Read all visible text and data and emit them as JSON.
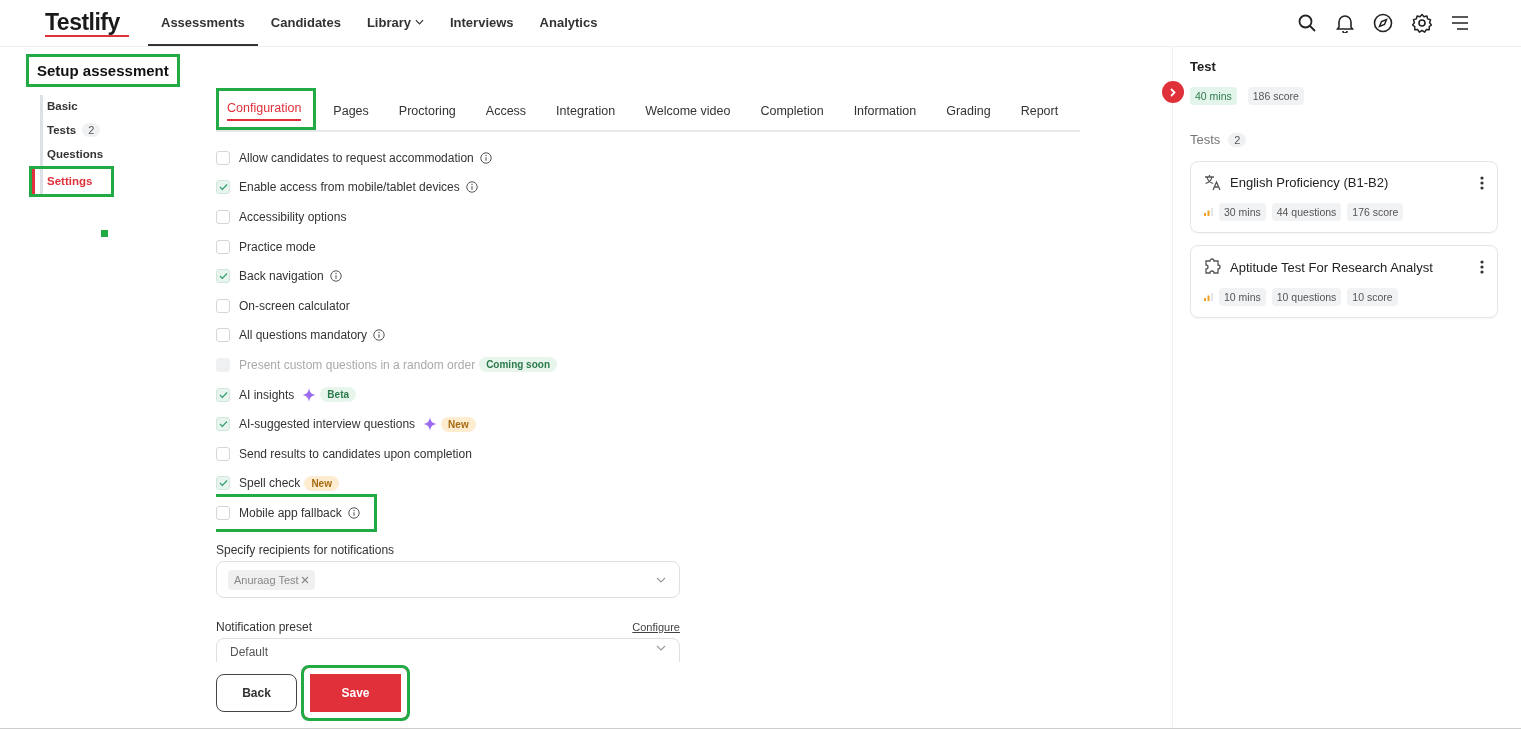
{
  "brand": {
    "name": "Testlify"
  },
  "nav": [
    {
      "label": "Assessments",
      "selected": true,
      "dropdown": false
    },
    {
      "label": "Candidates",
      "selected": false,
      "dropdown": false
    },
    {
      "label": "Library",
      "selected": false,
      "dropdown": true
    },
    {
      "label": "Interviews",
      "selected": false,
      "dropdown": false
    },
    {
      "label": "Analytics",
      "selected": false,
      "dropdown": false
    }
  ],
  "toolbar": [
    {
      "kind": "search"
    },
    {
      "kind": "bell"
    },
    {
      "kind": "compass"
    },
    {
      "kind": "gear"
    },
    {
      "kind": "menu"
    }
  ],
  "setup": {
    "title": "Setup assessment",
    "highlighted": true
  },
  "steps": [
    {
      "label": "Basic",
      "selected": false,
      "highlighted": false
    },
    {
      "label": "Tests",
      "count": "2",
      "selected": false,
      "highlighted": false
    },
    {
      "label": "Questions",
      "selected": false,
      "highlighted": false
    },
    {
      "label": "Settings",
      "selected": true,
      "highlighted": true
    }
  ],
  "tabs": [
    {
      "label": "Configuration",
      "selected": true,
      "highlighted": true
    },
    {
      "label": "Pages",
      "selected": false,
      "highlighted": false
    },
    {
      "label": "Proctoring",
      "selected": false,
      "highlighted": false
    },
    {
      "label": "Access",
      "selected": false,
      "highlighted": false
    },
    {
      "label": "Integration",
      "selected": false,
      "highlighted": false
    },
    {
      "label": "Welcome video",
      "selected": false,
      "highlighted": false
    },
    {
      "label": "Completion",
      "selected": false,
      "highlighted": false
    },
    {
      "label": "Information",
      "selected": false,
      "highlighted": false
    },
    {
      "label": "Grading",
      "selected": false,
      "highlighted": false
    },
    {
      "label": "Report",
      "selected": false,
      "highlighted": false
    }
  ],
  "options": [
    {
      "label": "Allow candidates to request accommodation",
      "checked": false,
      "disabled": false,
      "info": true,
      "sparkle": false,
      "highlighted": false
    },
    {
      "label": "Enable access from mobile/tablet devices",
      "checked": true,
      "disabled": false,
      "info": true,
      "sparkle": false,
      "highlighted": false
    },
    {
      "label": "Accessibility options",
      "checked": false,
      "disabled": false,
      "info": false,
      "sparkle": false,
      "highlighted": false
    },
    {
      "label": "Practice mode",
      "checked": false,
      "disabled": false,
      "info": false,
      "sparkle": false,
      "highlighted": false
    },
    {
      "label": "Back navigation",
      "checked": true,
      "disabled": false,
      "info": true,
      "sparkle": false,
      "highlighted": false
    },
    {
      "label": "On-screen calculator",
      "checked": false,
      "disabled": false,
      "info": false,
      "sparkle": false,
      "highlighted": false
    },
    {
      "label": "All questions mandatory",
      "checked": false,
      "disabled": false,
      "info": true,
      "sparkle": false,
      "highlighted": false
    },
    {
      "label": "Present custom questions in a random order",
      "checked": false,
      "disabled": true,
      "info": false,
      "sparkle": false,
      "highlighted": false,
      "badge": {
        "text": "Coming soon",
        "kind": "green"
      }
    },
    {
      "label": "AI insights",
      "checked": true,
      "disabled": false,
      "info": false,
      "sparkle": true,
      "highlighted": false,
      "badge": {
        "text": "Beta",
        "kind": "green"
      }
    },
    {
      "label": "AI-suggested interview questions",
      "checked": true,
      "disabled": false,
      "info": false,
      "sparkle": true,
      "highlighted": false,
      "badge": {
        "text": "New",
        "kind": "orange"
      }
    },
    {
      "label": "Send results to candidates upon completion",
      "checked": false,
      "disabled": false,
      "info": false,
      "sparkle": false,
      "highlighted": false
    },
    {
      "label": "Spell check",
      "checked": true,
      "disabled": false,
      "info": false,
      "sparkle": false,
      "highlighted": false,
      "badge": {
        "text": "New",
        "kind": "orange"
      }
    },
    {
      "label": "Mobile app fallback",
      "checked": false,
      "disabled": false,
      "info": true,
      "sparkle": false,
      "highlighted": true
    }
  ],
  "recipients": {
    "label": "Specify recipients for notifications",
    "chips": [
      "Anuraag Test"
    ]
  },
  "preset": {
    "label": "Notification preset",
    "link": "Configure",
    "value": "Default"
  },
  "buttons": [
    {
      "label": "Back",
      "kind": "secondary",
      "highlighted": false
    },
    {
      "label": "Save",
      "kind": "primary",
      "highlighted": true
    }
  ],
  "summary": {
    "title": "Test",
    "chips": [
      {
        "text": "40 mins",
        "kind": "green"
      },
      {
        "text": "186 score",
        "kind": "grey"
      }
    ],
    "tests_label": "Tests",
    "tests_count": "2"
  },
  "tests": [
    {
      "kind": "translate",
      "title": "English Proficiency (B1-B2)",
      "chips": [
        "30 mins",
        "44 questions",
        "176 score"
      ]
    },
    {
      "kind": "puzzle",
      "title": "Aptitude Test For Research Analyst",
      "chips": [
        "10 mins",
        "10 questions",
        "10 score"
      ]
    }
  ]
}
